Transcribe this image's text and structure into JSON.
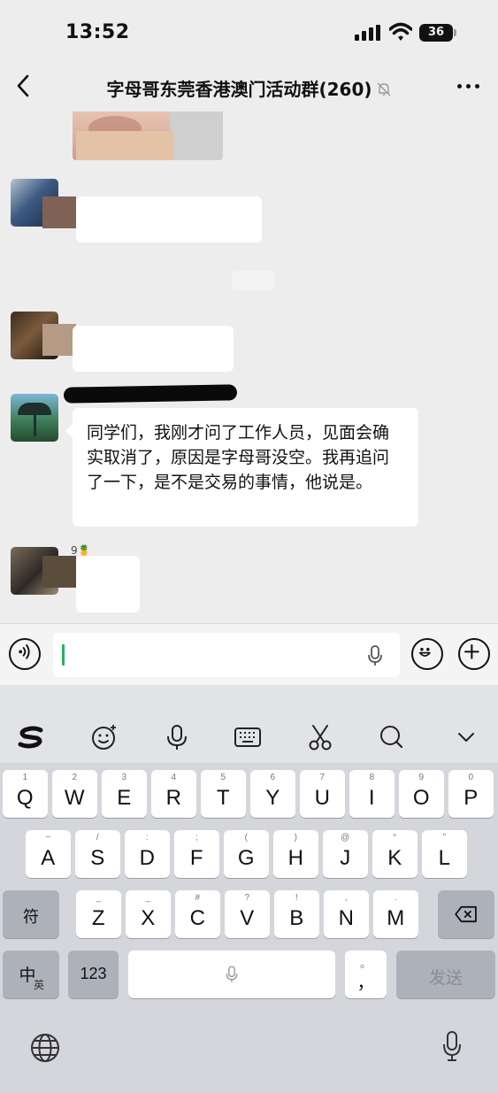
{
  "status": {
    "time": "13:52",
    "battery": "36"
  },
  "nav": {
    "title": "字母哥东莞香港澳门活动群",
    "member_count": "(260)"
  },
  "chat": {
    "message_text": "同学们，我刚才问了工作人员，见面会确实取消了，原因是字母哥没空。我再追问了一下，是不是交易的事情，他说是。",
    "last_sender_tag": "9🍍"
  },
  "keyboard": {
    "row1": [
      {
        "main": "Q",
        "sub": "1"
      },
      {
        "main": "W",
        "sub": "2"
      },
      {
        "main": "E",
        "sub": "3"
      },
      {
        "main": "R",
        "sub": "4"
      },
      {
        "main": "T",
        "sub": "5"
      },
      {
        "main": "Y",
        "sub": "6"
      },
      {
        "main": "U",
        "sub": "7"
      },
      {
        "main": "I",
        "sub": "8"
      },
      {
        "main": "O",
        "sub": "9"
      },
      {
        "main": "P",
        "sub": "0"
      }
    ],
    "row2": [
      {
        "main": "A",
        "sub": "~"
      },
      {
        "main": "S",
        "sub": "/"
      },
      {
        "main": "D",
        "sub": ":"
      },
      {
        "main": "F",
        "sub": ";"
      },
      {
        "main": "G",
        "sub": "("
      },
      {
        "main": "H",
        "sub": ")"
      },
      {
        "main": "J",
        "sub": "@"
      },
      {
        "main": "K",
        "sub": "“"
      },
      {
        "main": "L",
        "sub": "”"
      }
    ],
    "row3": [
      {
        "main": "Z",
        "sub": "_"
      },
      {
        "main": "X",
        "sub": "_"
      },
      {
        "main": "C",
        "sub": "#"
      },
      {
        "main": "V",
        "sub": "?"
      },
      {
        "main": "B",
        "sub": "!"
      },
      {
        "main": "N",
        "sub": ","
      },
      {
        "main": "M",
        "sub": "."
      }
    ],
    "symbol_key": "符",
    "lang_key": "中",
    "lang_key_sub": "英",
    "numbers_key": "123",
    "punct_key": "，",
    "punct_key_sub": "。",
    "send_key": "发送"
  },
  "colors": {
    "accent_green": "#21b45e",
    "chat_bg": "#ededed",
    "keyboard_bg": "#d4d6dc"
  }
}
